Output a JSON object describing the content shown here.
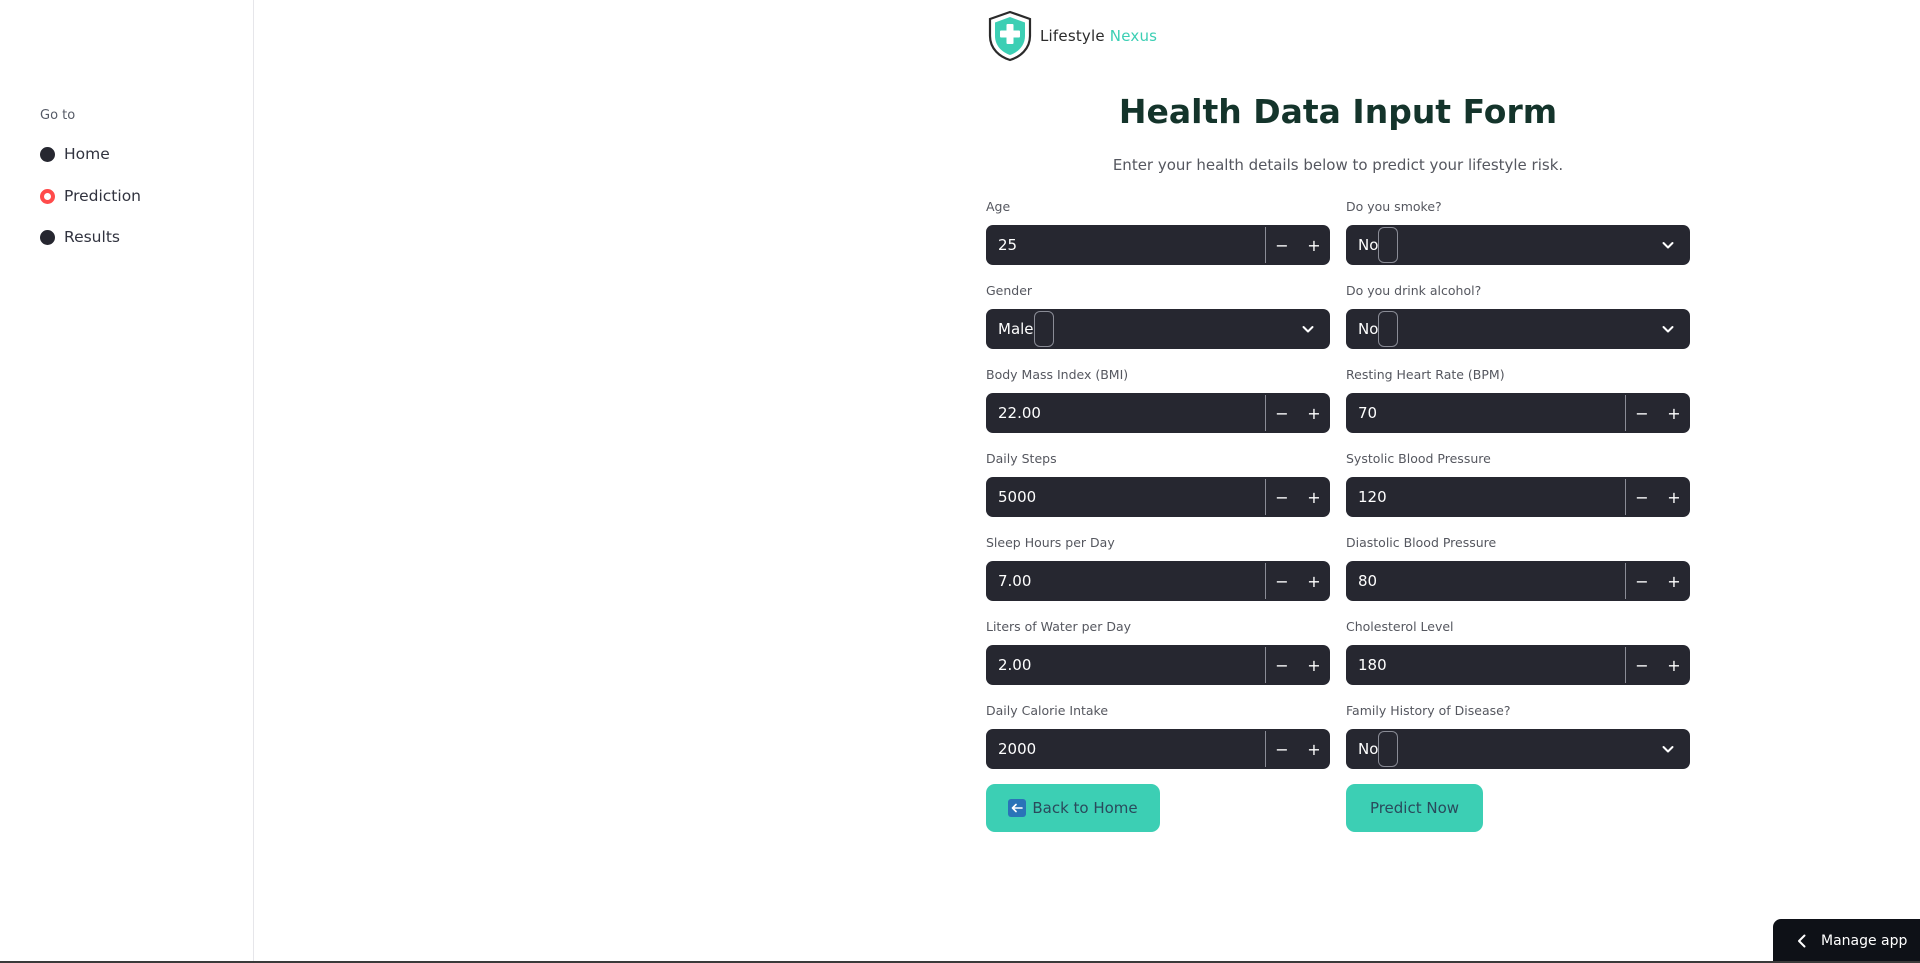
{
  "sidebar": {
    "heading": "Go to",
    "items": [
      {
        "label": "Home",
        "active": false
      },
      {
        "label": "Prediction",
        "active": true
      },
      {
        "label": "Results",
        "active": false
      }
    ]
  },
  "logo": {
    "text_main": "Lifestyle",
    "text_accent": "Nexus"
  },
  "header": {
    "title": "Health Data Input Form",
    "subtitle": "Enter your health details below to predict your lifestyle risk."
  },
  "form": {
    "age": {
      "label": "Age",
      "value": "25"
    },
    "smoke": {
      "label": "Do you smoke?",
      "value": "No"
    },
    "gender": {
      "label": "Gender",
      "value": "Male"
    },
    "alcohol": {
      "label": "Do you drink alcohol?",
      "value": "No"
    },
    "bmi": {
      "label": "Body Mass Index (BMI)",
      "value": "22.00"
    },
    "heart_rate": {
      "label": "Resting Heart Rate (BPM)",
      "value": "70"
    },
    "steps": {
      "label": "Daily Steps",
      "value": "5000"
    },
    "systolic": {
      "label": "Systolic Blood Pressure",
      "value": "120"
    },
    "sleep": {
      "label": "Sleep Hours per Day",
      "value": "7.00"
    },
    "diastolic": {
      "label": "Diastolic Blood Pressure",
      "value": "80"
    },
    "water": {
      "label": "Liters of Water per Day",
      "value": "2.00"
    },
    "cholesterol": {
      "label": "Cholesterol Level",
      "value": "180"
    },
    "calories": {
      "label": "Daily Calorie Intake",
      "value": "2000"
    },
    "family_history": {
      "label": "Family History of Disease?",
      "value": "No"
    },
    "minus": "−",
    "plus": "+"
  },
  "buttons": {
    "back": "Back to Home",
    "predict": "Predict Now"
  },
  "footer": {
    "manage_app": "Manage app"
  },
  "colors": {
    "accent": "#3ccfb4",
    "input_bg": "#262730",
    "radio_active": "#ff4b4b",
    "title": "#14342b"
  }
}
